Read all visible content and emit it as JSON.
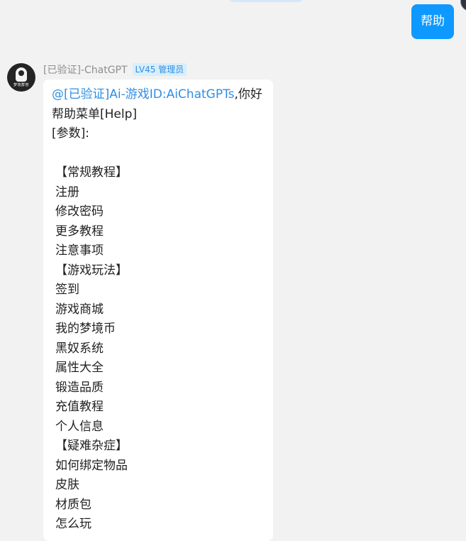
{
  "outgoing": {
    "text": "帮助"
  },
  "bot": {
    "avatar_text": "梦境群管",
    "sender_name": "[已验证]-ChatGPT",
    "level_badge": "LV45 管理员"
  },
  "message": {
    "mention": "@[已验证]Ai-游戏ID:AiChatGPTs",
    "greeting": ",你好",
    "menu_title": "帮助菜单[Help]",
    "params_label": "[参数]:",
    "sections": [
      {
        "title": "【常规教程】",
        "items": [
          "注册",
          "修改密码",
          "更多教程",
          "注意事项"
        ]
      },
      {
        "title": "【游戏玩法】",
        "items": [
          "签到",
          "游戏商城",
          "我的梦境币",
          "黑奴系统",
          "属性大全",
          "锻造品质",
          "充值教程",
          "个人信息"
        ]
      },
      {
        "title": "【疑难杂症】",
        "items": [
          "如何绑定物品",
          "皮肤",
          "材质包",
          "怎么玩"
        ]
      }
    ]
  }
}
